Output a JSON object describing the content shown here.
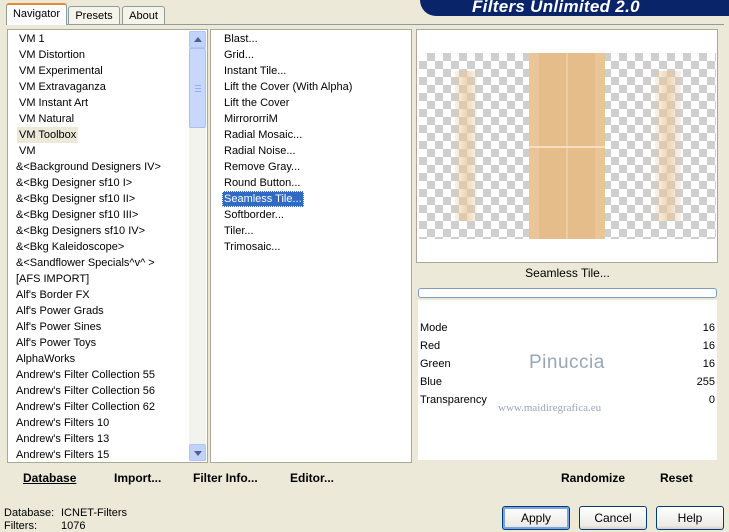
{
  "tabs": [
    {
      "label": "Navigator",
      "active": true
    },
    {
      "label": "Presets",
      "active": false
    },
    {
      "label": "About",
      "active": false
    }
  ],
  "banner": "Filters Unlimited 2.0",
  "categories": [
    "VM 1",
    "VM Distortion",
    "VM Experimental",
    "VM Extravaganza",
    "VM Instant Art",
    "VM Natural",
    "VM Toolbox",
    "VM",
    "&<Background Designers IV>",
    "&<Bkg Designer sf10 I>",
    "&<Bkg Designer sf10 II>",
    "&<Bkg Designer sf10 III>",
    "&<Bkg Designers sf10 IV>",
    "&<Bkg Kaleidoscope>",
    "&<Sandflower Specials^v^ >",
    "[AFS IMPORT]",
    "Alf's Border FX",
    "Alf's Power Grads",
    "Alf's Power Sines",
    "Alf's Power Toys",
    "AlphaWorks",
    "Andrew's Filter Collection 55",
    "Andrew's Filter Collection 56",
    "Andrew's Filter Collection 62",
    "Andrew's Filters 10",
    "Andrew's Filters 13",
    "Andrew's Filters 15"
  ],
  "selected_category": "VM Toolbox",
  "filters": [
    "Blast...",
    "Grid...",
    "Instant Tile...",
    "Lift the Cover (With Alpha)",
    "Lift the Cover",
    "MirrororriM",
    "Radial Mosaic...",
    "Radial Noise...",
    "Remove Gray...",
    "Round Button...",
    "Seamless Tile...",
    "Softborder...",
    "Tiler...",
    "Trimosaic..."
  ],
  "selected_filter": "Seamless Tile...",
  "preview": {
    "filter_name": "Seamless Tile...",
    "progress": 0
  },
  "params": [
    {
      "label": "Mode",
      "value": "16"
    },
    {
      "label": "Red",
      "value": "16"
    },
    {
      "label": "Green",
      "value": "16"
    },
    {
      "label": "Blue",
      "value": "255"
    },
    {
      "label": "Transparency",
      "value": "0"
    }
  ],
  "watermark": {
    "name": "Pinuccia",
    "site": "www.maidiregrafica.eu"
  },
  "bottom_bar": {
    "database": "Database",
    "import": "Import...",
    "filter_info": "Filter Info...",
    "editor": "Editor...",
    "randomize": "Randomize",
    "reset": "Reset"
  },
  "status": {
    "database_label": "Database:",
    "database_value": "ICNET-Filters",
    "filters_label": "Filters:",
    "filters_value": "1076"
  },
  "dialog_buttons": {
    "apply": "Apply",
    "cancel": "Cancel",
    "help": "Help"
  },
  "colors": {
    "selection": "#316ac5",
    "tile": "#e7c69a",
    "banner": "#0a246a"
  }
}
